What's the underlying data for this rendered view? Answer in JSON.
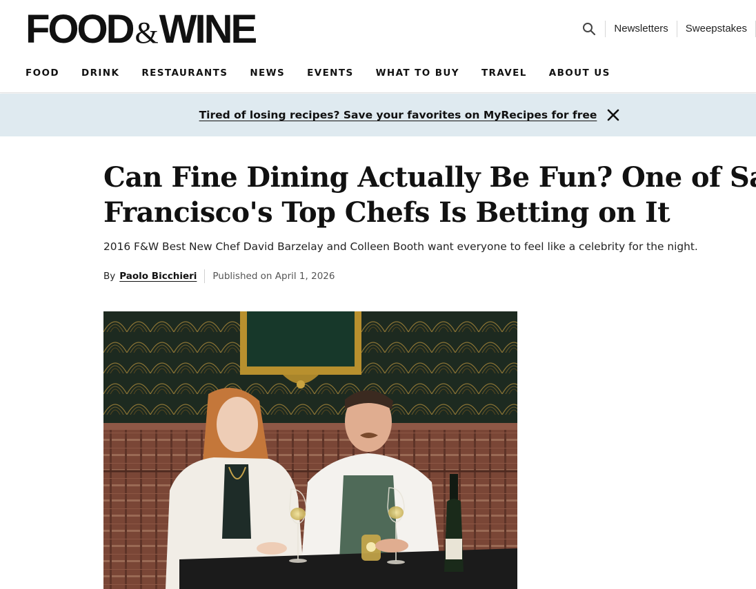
{
  "header": {
    "logo": {
      "word1": "FOOD",
      "amp": "&",
      "word2": "WINE"
    },
    "utility_links": [
      "Newsletters",
      "Sweepstakes"
    ],
    "search_icon": "search-icon",
    "nav": [
      "FOOD",
      "DRINK",
      "RESTAURANTS",
      "NEWS",
      "EVENTS",
      "WHAT TO BUY",
      "TRAVEL",
      "ABOUT US"
    ]
  },
  "banner": {
    "text": "Tired of losing recipes? Save your favorites on MyRecipes for free",
    "close_icon": "close-icon",
    "background": "#dfeaf0"
  },
  "article": {
    "headline_line1": "Can Fine Dining Actually Be Fun? One of San",
    "headline_line2": "Francisco's Top Chefs Is Betting on It",
    "dek": "2016 F&W Best New Chef David Barzelay and Colleen Booth want everyone to feel like a celebrity for the night.",
    "by_label": "By",
    "author": "Paolo Bicchieri",
    "published": "Published on April 1, 2026"
  }
}
